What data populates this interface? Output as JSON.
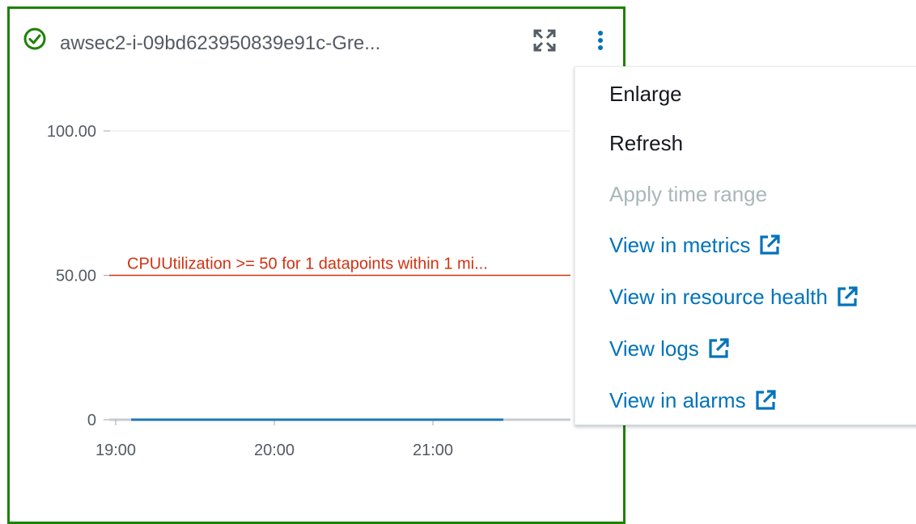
{
  "widget": {
    "title": "awsec2-i-09bd623950839e91c-Gre...",
    "status": "ok",
    "status_color": "#1d8102",
    "icons": {
      "status": "check-circle-icon",
      "expand": "expand-icon",
      "menu": "kebab-menu-icon"
    }
  },
  "chart_data": {
    "type": "line",
    "y_ticks": [
      "100.00",
      "50.00",
      "0"
    ],
    "x_ticks": [
      "19:00",
      "20:00",
      "21:00"
    ],
    "ylim": [
      0,
      100
    ],
    "threshold": {
      "value": 50,
      "label": "CPUUtilization >= 50 for 1 datapoints within 1 mi...",
      "color": "#d13212"
    },
    "series": [
      {
        "values": [
          0,
          0,
          0,
          0
        ],
        "color": "#1f77b4"
      }
    ],
    "grid": true
  },
  "menu": {
    "items": [
      {
        "label": "Enlarge",
        "state": "enabled",
        "external": false
      },
      {
        "label": "Refresh",
        "state": "enabled",
        "external": false
      },
      {
        "label": "Apply time range",
        "state": "disabled",
        "external": false
      },
      {
        "label": "View in metrics",
        "state": "link",
        "external": true
      },
      {
        "label": "View in resource health",
        "state": "link",
        "external": true
      },
      {
        "label": "View logs",
        "state": "link",
        "external": true
      },
      {
        "label": "View in alarms",
        "state": "link",
        "external": true
      }
    ],
    "link_color": "#0073bb",
    "disabled_color": "#aab7b8"
  }
}
